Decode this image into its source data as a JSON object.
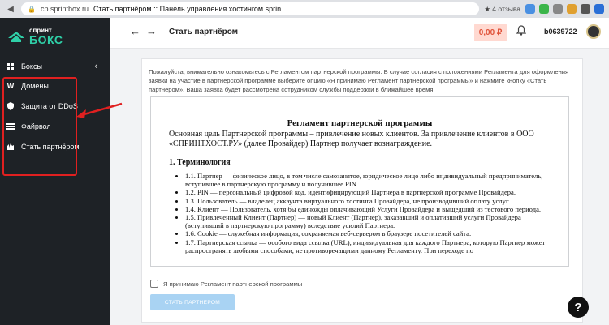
{
  "browser": {
    "url": "cp.sprintbox.ru",
    "tab_title": "Стать партнёром :: Панель управления хостингом sprin...",
    "reviews": "★ 4 отзыва"
  },
  "logo": {
    "line1": "спринт",
    "line2": "БОКС"
  },
  "sidebar": {
    "items": [
      {
        "label": "Боксы",
        "icon": "boxes-icon"
      },
      {
        "label": "Домены",
        "icon": "domains-icon"
      },
      {
        "label": "Защита от DDoS",
        "icon": "shield-icon"
      },
      {
        "label": "Файрвол",
        "icon": "firewall-icon"
      },
      {
        "label": "Стать партнёром",
        "icon": "partner-icon"
      }
    ]
  },
  "header": {
    "title": "Стать партнёром",
    "balance": "0,00 ₽",
    "username": "b0639722"
  },
  "content": {
    "intro": "Пожалуйста, внимательно ознакомьтесь с Регламентом партнерской программы. В случае согласия с положениями Регламента для оформления заявки на участие в партнерской программе выберите опцию «Я принимаю Регламент партнерской программы» и нажмите кнопку «Стать партнером». Ваша заявка будет рассмотрена сотрудником службы поддержки в ближайшее время.",
    "doc_title": "Регламент партнерской программы",
    "doc_paragraph": "Основная цель Партнерской программы – привлечение новых клиентов. За привлечение клиентов в ООО «СПРИНТХОСТ.РУ» (далее Провайдер) Партнер получает вознаграждение.",
    "doc_heading": "1. Терминология",
    "terms": [
      "1.1. Партнер — физическое лицо, в том числе самозанятое, юридическое лицо либо индивидуальный предприниматель, вступившее в партнерскую программу и получившее PIN.",
      "1.2. PIN — персональный цифровой код, идентифицирующий Партнера в партнерской программе Провайдера.",
      "1.3. Пользователь — владелец аккаунта виртуального хостинга Провайдера, не производивший оплату услуг.",
      "1.4. Клиент — Пользователь, хотя бы единожды оплачивающий Услуги Провайдера и выщедший из тестового периода.",
      "1.5. Привлеченный Клиент (Партнер) — новый Клиент (Партнер), заказавший и оплативший услуги Провайдера (вступивший в партнерскую программу) вследствие усилий Партнера.",
      "1.6. Cookie — служебная информация, сохраняемая веб-сервером в браузере посетителей сайта.",
      "1.7. Партнерская ссылка — особого вида ссылка (URL), индивидуальная для каждого Партнера, которую Партнер может распространять любыми способами, не противоречащими данному Регламенту. При переходе по"
    ],
    "agree_label": "Я принимаю Регламент партнерской программы",
    "submit_label": "СТАТЬ ПАРТНЕРОМ"
  },
  "help_label": "?",
  "colors": {
    "brand": "#2fd0a8",
    "sidebar_bg": "#1e2226",
    "balance": "#e0533a",
    "highlight": "#e02020",
    "button": "#a9d3f3"
  }
}
